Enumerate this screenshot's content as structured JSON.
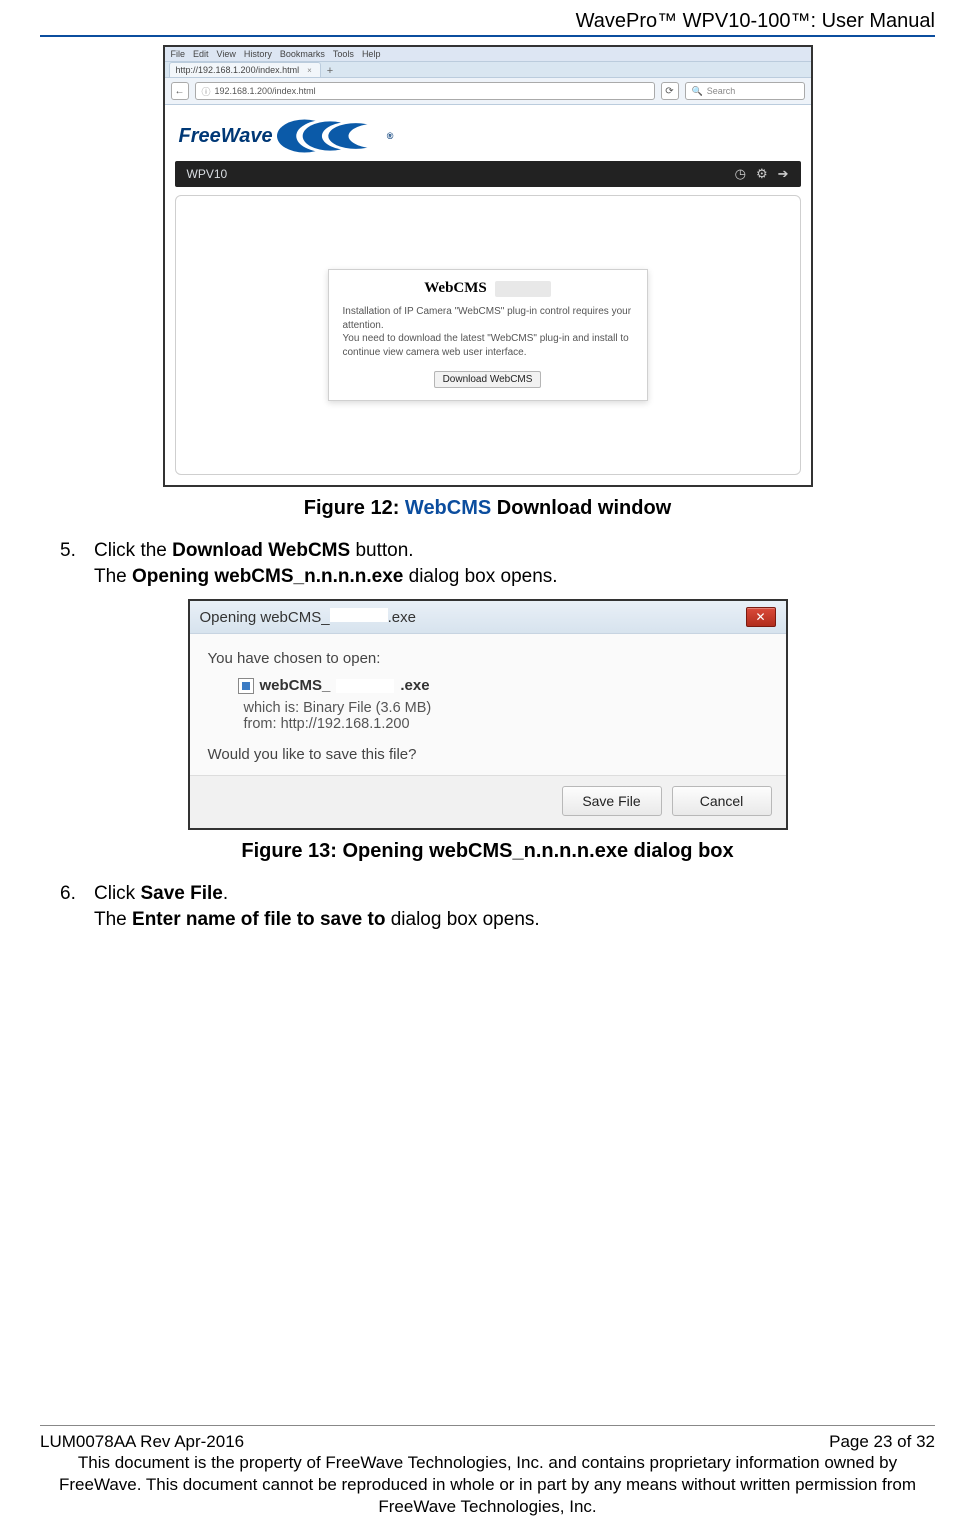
{
  "header": {
    "title": "WavePro™ WPV10-100™: User Manual"
  },
  "figure12": {
    "menu": [
      "File",
      "Edit",
      "View",
      "History",
      "Bookmarks",
      "Tools",
      "Help"
    ],
    "tab": "http://192.168.1.200/index.html",
    "url": "192.168.1.200/index.html",
    "search_placeholder": "Search",
    "logo": "FreeWave",
    "appbar_label": "WPV10",
    "modal_title": "WebCMS",
    "modal_line1": "Installation of IP Camera \"WebCMS\" plug-in control requires your attention.",
    "modal_line2": "You need to download the latest \"WebCMS\" plug-in and install to continue view camera web user interface.",
    "modal_button": "Download WebCMS",
    "caption_prefix": "Figure 12: ",
    "caption_link": "WebCMS",
    "caption_suffix": " Download window"
  },
  "step5": {
    "num": "5.",
    "text_a": "Click the ",
    "text_bold": "Download WebCMS",
    "text_b": " button.",
    "sub_a": "The ",
    "sub_bold": "Opening webCMS_n.n.n.n.exe",
    "sub_b": " dialog box opens."
  },
  "figure13": {
    "title_a": "Opening webCMS_",
    "title_b": ".exe",
    "line1": "You have chosen to open:",
    "file_a": "webCMS_",
    "file_b": ".exe",
    "which_label": "which is:",
    "which_value": "Binary File (3.6 MB)",
    "from_label": "from:",
    "from_value": "http://192.168.1.200",
    "prompt": "Would you like to save this file?",
    "save_btn": "Save File",
    "cancel_btn": "Cancel",
    "caption": "Figure 13: Opening webCMS_n.n.n.n.exe dialog box"
  },
  "step6": {
    "num": "6.",
    "text_a": "Click ",
    "text_bold": "Save File",
    "text_b": ".",
    "sub_a": "The ",
    "sub_bold": "Enter name of file to save to",
    "sub_b": " dialog box opens."
  },
  "footer": {
    "left": "LUM0078AA Rev Apr-2016",
    "right": "Page 23 of 32",
    "notice": "This document is the property of FreeWave Technologies, Inc. and contains proprietary information owned by FreeWave. This document cannot be reproduced in whole or in part by any means without written permission from FreeWave Technologies, Inc."
  }
}
